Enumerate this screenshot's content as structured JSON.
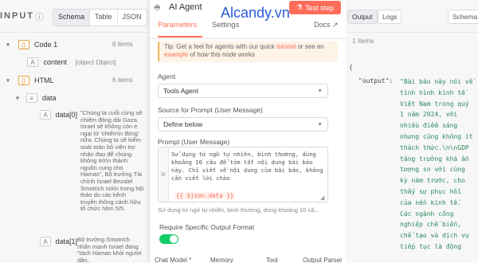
{
  "input_pane": {
    "title": "INPUT",
    "tabs": [
      "Schema",
      "Table",
      "JSON"
    ],
    "tree": [
      {
        "name": "Code 1",
        "type_icon": "{}",
        "count": "6 items"
      },
      {
        "name": "content",
        "type_icon": "A",
        "value": "[object Object]"
      },
      {
        "name": "HTML",
        "type_icon": "{}",
        "count": "6 items"
      },
      {
        "name": "data",
        "type_icon": "list"
      },
      {
        "name": "data[0]",
        "type_icon": "A",
        "value": "\"Chúng ta cuối cùng sẽ chiếm đóng dải Gaza. Israel sẽ không còn e ngại từ 'chiếm\\n đóng' nữa. Chúng ta sẽ kiểm soát toàn bộ viện trợ nhân đạo để chúng không trở\\n thành nguồn cung cho Hamas\", Bộ trưởng Tài chính Israel Bezalel Smotrich nói\\n trong hội thảo do các kênh truyền thông cánh hữu tổ chức hôm 5/5."
      },
      {
        "name": "data[1]",
        "type_icon": "A",
        "value": "Bộ trưởng Smotrich nhấn mạnh Israel đang \"tách Hamas khỏi người dân,"
      }
    ]
  },
  "node": {
    "icon": "robot-icon",
    "title": "AI Agent",
    "test_button": "Test step",
    "tabs": [
      "Parameters",
      "Settings"
    ],
    "docs": "Docs",
    "tip": {
      "prefix": "Tip: Get a feel for agents with our quick ",
      "link1": "tutorial",
      "middle": " or see an ",
      "link2": "example",
      "suffix": " of how this node works"
    },
    "agent_label": "Agent",
    "agent_value": "Tools Agent",
    "source_label": "Source for Prompt (User Message)",
    "source_value": "Define below",
    "prompt_label": "Prompt (User Message)",
    "prompt_text": "Sử dụng từ ngữ tự nhiên, bình thường, dùng khoảng 10 câu để tóm tắt nội dung bài báo này. Chỉ viết về nội dung của bài báo, không cần viết lời chào",
    "prompt_expr": "{{ $json.data }}",
    "prompt_preview": "Sử dụng từ ngữ tự nhiên, bình thường, dùng khoảng 10 câ...",
    "output_format_label": "Require Specific Output Format",
    "output_format_on": true,
    "bottom_tabs": [
      "Chat Model *",
      "Memory",
      "Tool",
      "Output Parser"
    ]
  },
  "watermark": "Alcandy.vn",
  "output_pane": {
    "tabs": [
      "Output",
      "Logs"
    ],
    "schema_tab": "Schema",
    "items": "1 items",
    "json_open": "{",
    "json_key": "\"output\":",
    "json_value": "\"Bài báo này nói về tình hình kinh tế Việt Nam trong quý 1 năm 2024, với nhiều điểm sáng nhưng cũng không ít thách thức.\\n\\nGDP tăng trưởng khá ấn tượng so với cùng kỳ năm trước, cho thấy sự phục hồi của nền kinh tế. Các ngành công nghiệp chế biến, chế tạo và dịch vụ tiếp tục là động"
  },
  "colors": {
    "accent": "#ff6d5a",
    "toggle_on": "#13ce66",
    "json_string": "#2d8a5b",
    "watermark": "#2a5bd7"
  }
}
